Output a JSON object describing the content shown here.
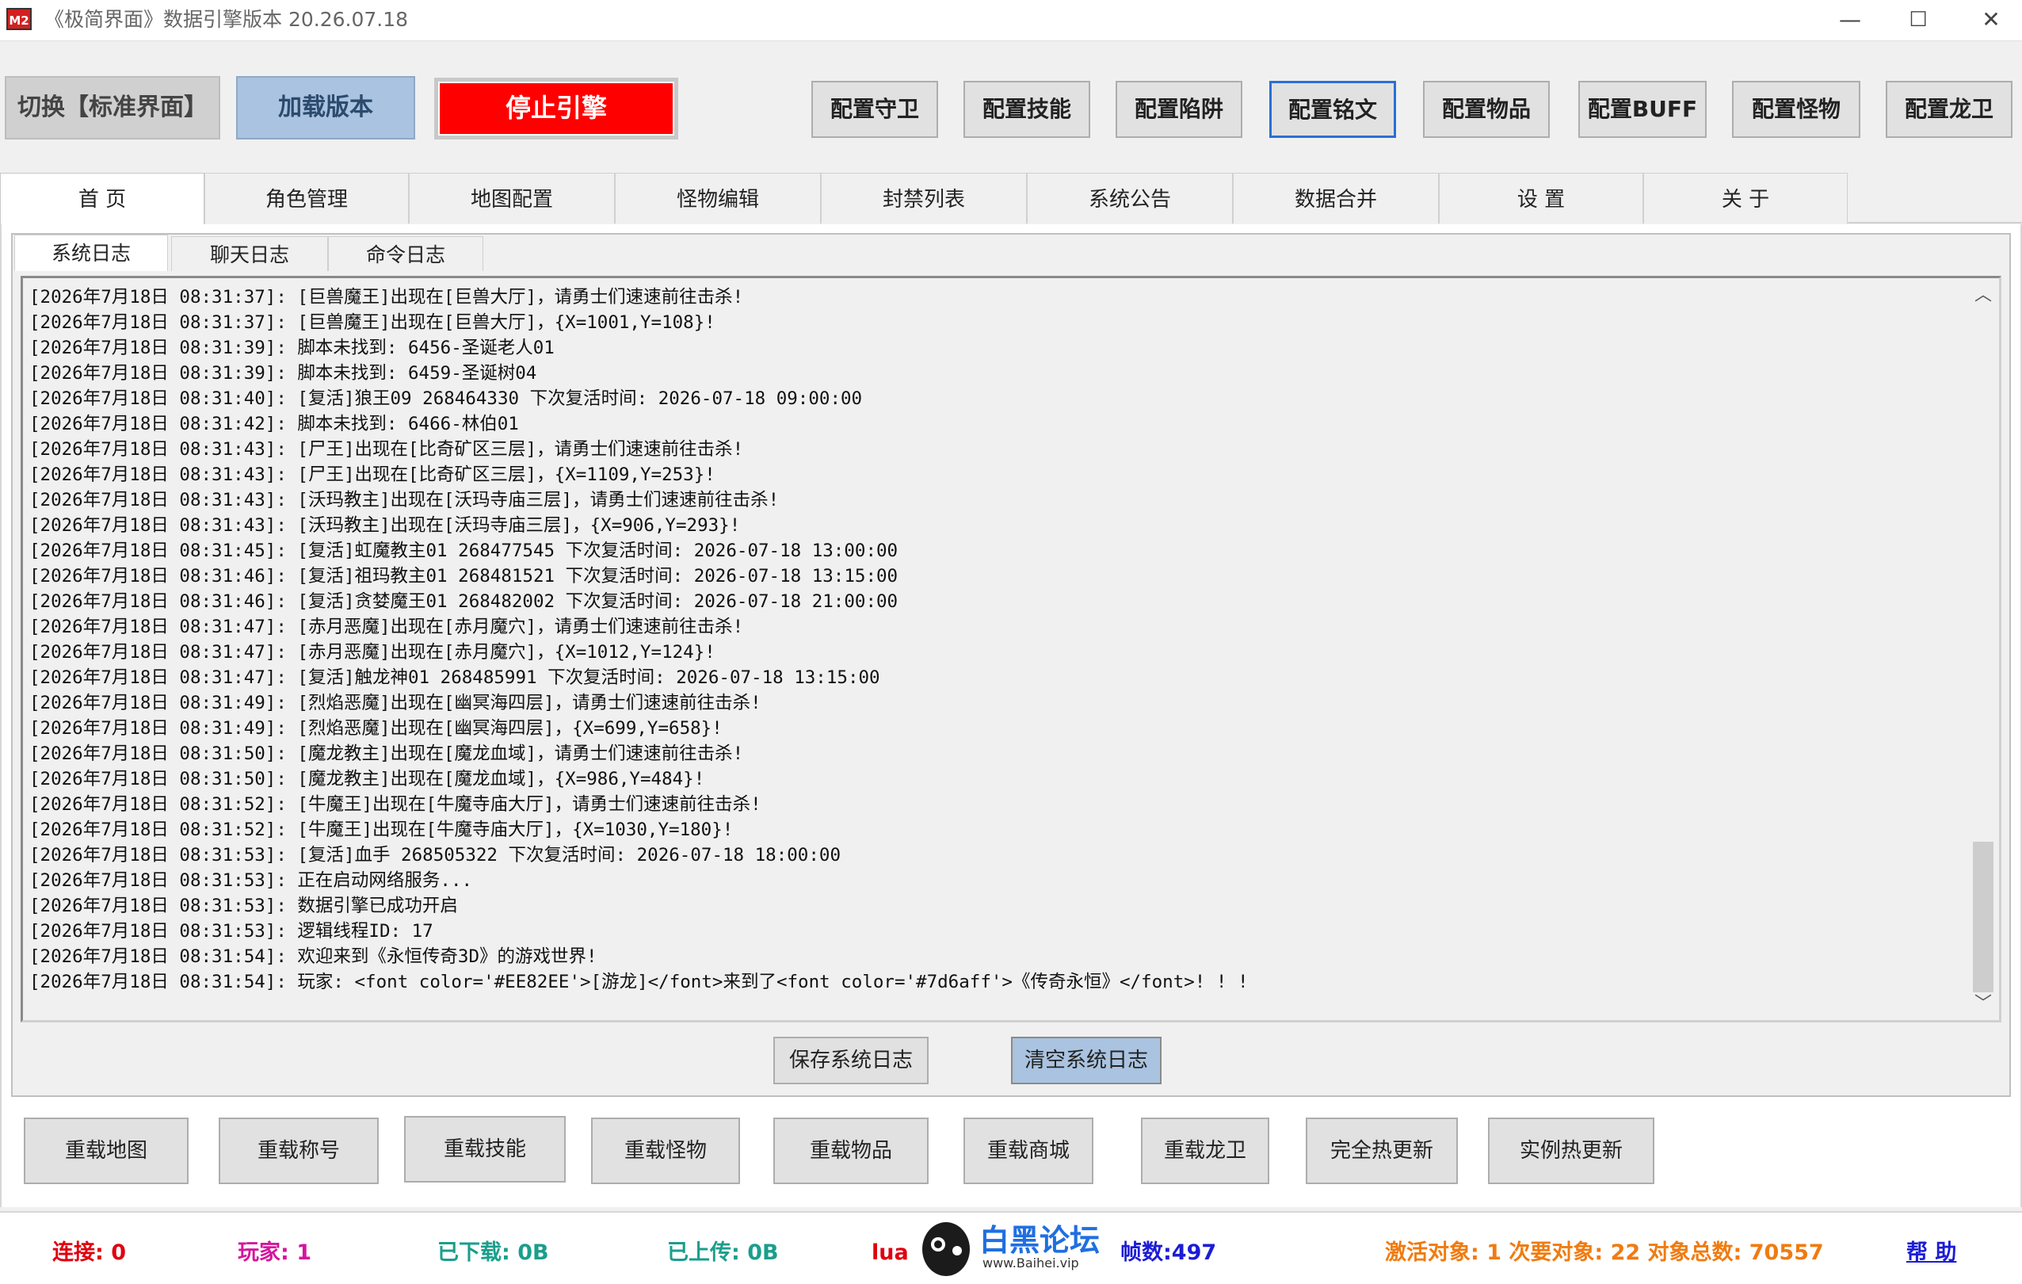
{
  "window": {
    "icon_text": "M2",
    "title": "《极简界面》数据引擎版本 20.26.07.18",
    "minimize": "—",
    "maximize": "☐",
    "close": "✕"
  },
  "toolbar": {
    "switch_ui": "切换【标准界面】",
    "load_version": "加载版本",
    "stop_engine": "停止引擎",
    "config_buttons": [
      "配置守卫",
      "配置技能",
      "配置陷阱",
      "配置铭文",
      "配置物品",
      "配置BUFF",
      "配置怪物",
      "配置龙卫"
    ]
  },
  "main_tabs": [
    "首 页",
    "角色管理",
    "地图配置",
    "怪物编辑",
    "封禁列表",
    "系统公告",
    "数据合并",
    "设 置",
    "关 于"
  ],
  "sub_tabs": [
    "系统日志",
    "聊天日志",
    "命令日志"
  ],
  "log_lines": [
    "[2026年7月18日 08:31:37]: [巨兽魔王]出现在[巨兽大厅]，请勇士们速速前往击杀!",
    "[2026年7月18日 08:31:37]: [巨兽魔王]出现在[巨兽大厅]，{X=1001,Y=108}!",
    "[2026年7月18日 08:31:39]: 脚本未找到: 6456-圣诞老人01",
    "[2026年7月18日 08:31:39]: 脚本未找到: 6459-圣诞树04",
    "[2026年7月18日 08:31:40]: [复活]狼王09 268464330 下次复活时间: 2026-07-18 09:00:00",
    "[2026年7月18日 08:31:42]: 脚本未找到: 6466-林伯01",
    "[2026年7月18日 08:31:43]: [尸王]出现在[比奇矿区三层]，请勇士们速速前往击杀!",
    "[2026年7月18日 08:31:43]: [尸王]出现在[比奇矿区三层]，{X=1109,Y=253}!",
    "[2026年7月18日 08:31:43]: [沃玛教主]出现在[沃玛寺庙三层]，请勇士们速速前往击杀!",
    "[2026年7月18日 08:31:43]: [沃玛教主]出现在[沃玛寺庙三层]，{X=906,Y=293}!",
    "[2026年7月18日 08:31:45]: [复活]虹魔教主01 268477545 下次复活时间: 2026-07-18 13:00:00",
    "[2026年7月18日 08:31:46]: [复活]祖玛教主01 268481521 下次复活时间: 2026-07-18 13:15:00",
    "[2026年7月18日 08:31:46]: [复活]贪婪魔王01 268482002 下次复活时间: 2026-07-18 21:00:00",
    "[2026年7月18日 08:31:47]: [赤月恶魔]出现在[赤月魔穴]，请勇士们速速前往击杀!",
    "[2026年7月18日 08:31:47]: [赤月恶魔]出现在[赤月魔穴]，{X=1012,Y=124}!",
    "[2026年7月18日 08:31:47]: [复活]触龙神01 268485991 下次复活时间: 2026-07-18 13:15:00",
    "[2026年7月18日 08:31:49]: [烈焰恶魔]出现在[幽冥海四层]，请勇士们速速前往击杀!",
    "[2026年7月18日 08:31:49]: [烈焰恶魔]出现在[幽冥海四层]，{X=699,Y=658}!",
    "[2026年7月18日 08:31:50]: [魔龙教主]出现在[魔龙血域]，请勇士们速速前往击杀!",
    "[2026年7月18日 08:31:50]: [魔龙教主]出现在[魔龙血域]，{X=986,Y=484}!",
    "[2026年7月18日 08:31:52]: [牛魔王]出现在[牛魔寺庙大厅]，请勇士们速速前往击杀!",
    "[2026年7月18日 08:31:52]: [牛魔王]出现在[牛魔寺庙大厅]，{X=1030,Y=180}!",
    "[2026年7月18日 08:31:53]: [复活]血手 268505322 下次复活时间: 2026-07-18 18:00:00",
    "[2026年7月18日 08:31:53]: 正在启动网络服务...",
    "[2026年7月18日 08:31:53]: 数据引擎已成功开启",
    "[2026年7月18日 08:31:53]: 逻辑线程ID: 17",
    "[2026年7月18日 08:31:54]: 欢迎来到《永恒传奇3D》的游戏世界!",
    "[2026年7月18日 08:31:54]: 玩家: <font color='#EE82EE'>[游龙]</font>来到了<font color='#7d6aff'>《传奇永恒》</font>! ! !"
  ],
  "log_actions": {
    "save": "保存系统日志",
    "clear": "清空系统日志"
  },
  "reload_buttons": [
    "重载地图",
    "重载称号",
    "重载技能",
    "重载怪物",
    "重载物品",
    "重载商城",
    "重载龙卫",
    "完全热更新",
    "实例热更新"
  ],
  "status": {
    "connections": "连接: 0",
    "players": "玩家: 1",
    "downloaded": "已下载: 0B",
    "uploaded": "已上传: 0B",
    "lua": "lua",
    "frames": "帧数:497",
    "objects": "激活对象: 1  次要对象: 22  对象总数: 70557",
    "help": "帮 助"
  },
  "watermark": {
    "name": "白黑论坛",
    "url": "www.Baihei.vip"
  },
  "colors": {
    "stop_button": "#ff0000",
    "highlight_button": "#a9c3e0",
    "status_red": "#e0000f",
    "status_magenta": "#d4169c",
    "status_teal": "#1b9e8c",
    "status_blue": "#1c1cd6",
    "status_orange": "#f07b10"
  }
}
